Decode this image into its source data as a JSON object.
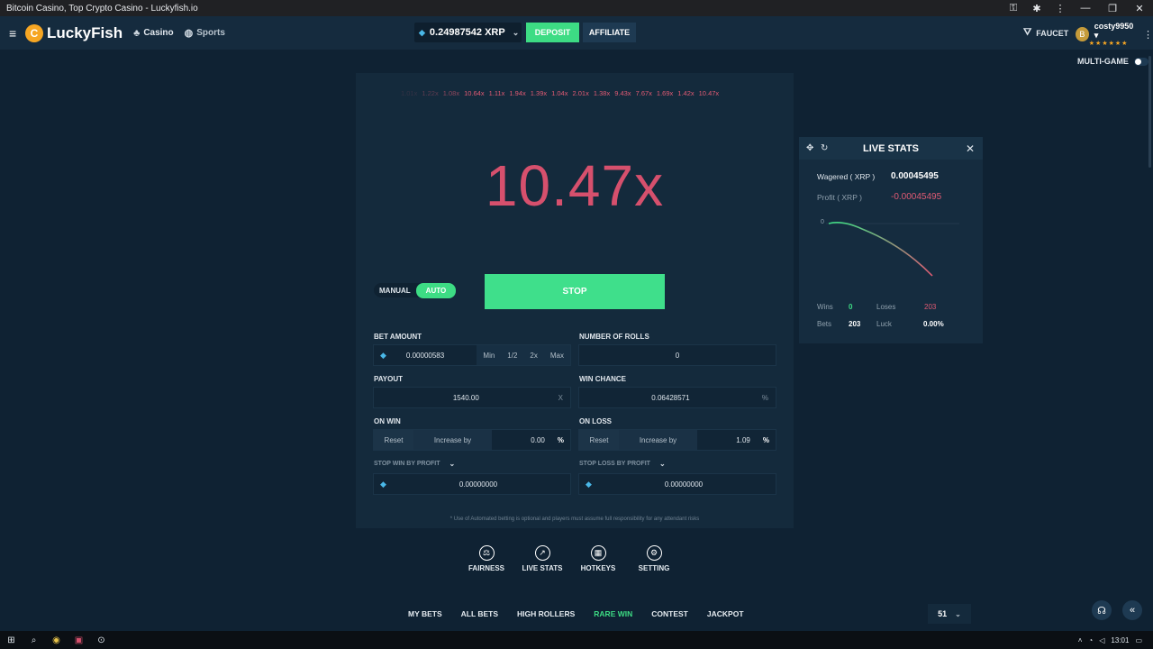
{
  "browser": {
    "window_title": "Bitcoin Casino, Top Crypto Casino - Luckyfish.io"
  },
  "nav": {
    "logo_text": "LuckyFish",
    "casino": "Casino",
    "sports": "Sports",
    "balance": "0.24987542 XRP",
    "deposit": "DEPOSIT",
    "affiliate": "AFFILIATE",
    "faucet": "FAUCET",
    "username": "costy9950",
    "level_stars": "★★★★★★"
  },
  "multigame": "MULTI-GAME",
  "game": {
    "history": [
      "1.01x",
      "1.22x",
      "1.08x",
      "10.64x",
      "1.11x",
      "1.94x",
      "1.39x",
      "1.04x",
      "2.01x",
      "1.38x",
      "9.43x",
      "7.67x",
      "1.69x",
      "1.42x",
      "10.47x"
    ],
    "result": "10.47x",
    "mode_manual": "MANUAL",
    "mode_auto": "AUTO",
    "stop_button": "STOP",
    "bet_amount_label": "BET AMOUNT",
    "bet_amount": "0.00000583",
    "bet_min": "Min",
    "bet_half": "1/2",
    "bet_double": "2x",
    "bet_max": "Max",
    "rolls_label": "NUMBER OF ROLLS",
    "rolls": "0",
    "payout_label": "PAYOUT",
    "payout": "1540.00",
    "payout_suffix": "X",
    "winchance_label": "WIN CHANCE",
    "winchance": "0.06428571",
    "winchance_suffix": "%",
    "onwin_label": "ON WIN",
    "onwin_reset": "Reset",
    "onwin_increase": "Increase by",
    "onwin_value": "0.00",
    "onwin_pct": "%",
    "onloss_label": "ON LOSS",
    "onloss_reset": "Reset",
    "onloss_increase": "Increase by",
    "onloss_value": "1.09",
    "onloss_pct": "%",
    "stopwin_label": "STOP WIN BY PROFIT",
    "stopwin_value": "0.00000000",
    "stoploss_label": "STOP LOSS BY PROFIT",
    "stoploss_value": "0.00000000",
    "disclaimer": "* Use of Automated betting is optional and players must assume full responsibility for any attendant risks"
  },
  "live_stats": {
    "title": "LIVE STATS",
    "wagered_label": "Wagered ( XRP )",
    "wagered": "0.00045495",
    "profit_label": "Profit ( XRP )",
    "profit": "-0.00045495",
    "graph_zero": "0",
    "wins_label": "Wins",
    "wins": "0",
    "loses_label": "Loses",
    "loses": "203",
    "bets_label": "Bets",
    "bets": "203",
    "luck_label": "Luck",
    "luck": "0.00%",
    "colors": {
      "win": "#3ddc84",
      "loss": "#e05a73"
    }
  },
  "tools": {
    "fairness": "FAIRNESS",
    "live_stats": "LIVE STATS",
    "hotkeys": "HOTKEYS",
    "setting": "SETTING"
  },
  "tabs": [
    "MY BETS",
    "ALL BETS",
    "HIGH ROLLERS",
    "RARE WIN",
    "CONTEST",
    "JACKPOT"
  ],
  "active_tab": "RARE WIN",
  "rows_count": "51",
  "taskbar": {
    "time": "13:01"
  },
  "colors": {
    "accent": "#3ddc84",
    "danger": "#e05a73",
    "background": "#0f2233",
    "panel": "#142a3c"
  }
}
